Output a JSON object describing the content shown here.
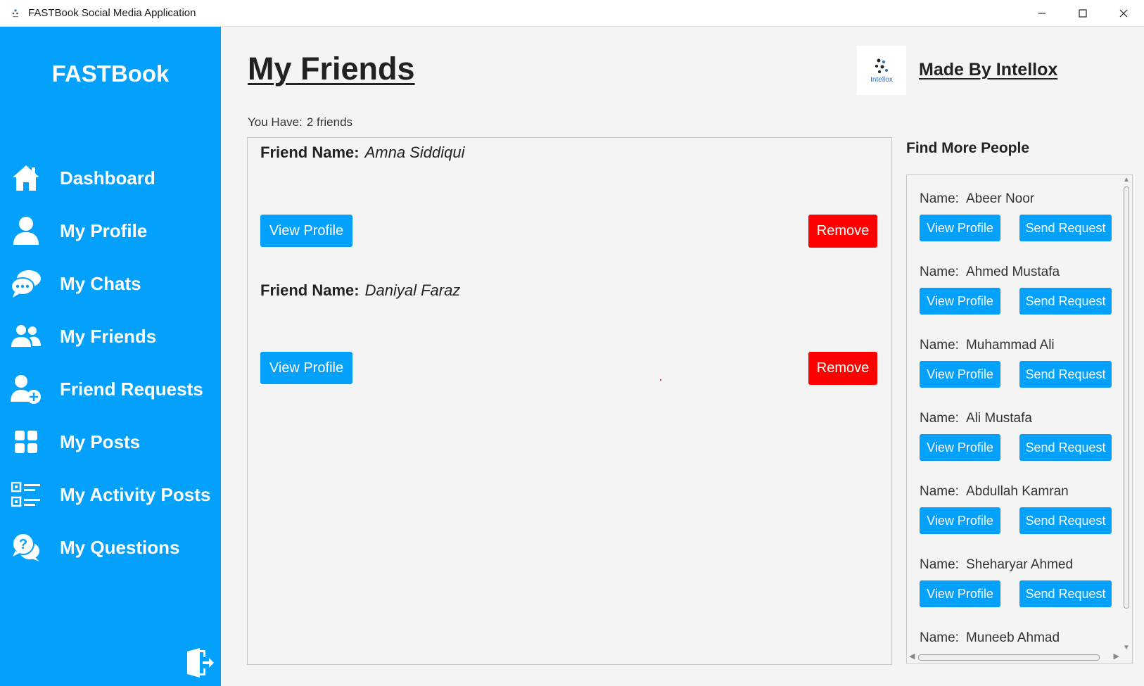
{
  "window": {
    "title": "FASTBook Social Media Application",
    "controls": [
      "minimize",
      "maximize",
      "close"
    ]
  },
  "sidebar": {
    "brand": "FASTBook",
    "items": [
      {
        "label": "Dashboard",
        "icon": "home-icon"
      },
      {
        "label": "My Profile",
        "icon": "user-icon"
      },
      {
        "label": "My Chats",
        "icon": "chat-icon"
      },
      {
        "label": "My Friends",
        "icon": "friends-icon"
      },
      {
        "label": "Friend Requests",
        "icon": "add-user-icon"
      },
      {
        "label": "My Posts",
        "icon": "grid-icon"
      },
      {
        "label": "My Activity Posts",
        "icon": "list-icon"
      },
      {
        "label": "My Questions",
        "icon": "question-chat-icon"
      }
    ],
    "logout_icon": "logout-icon"
  },
  "header": {
    "title": "My Friends",
    "logo_text": "Intellox",
    "made_by": "Made By Intellox"
  },
  "friends": {
    "count_label": "You Have:",
    "count_value": "2 friends",
    "name_label": "Friend Name:",
    "view_label": "View Profile",
    "remove_label": "Remove",
    "list": [
      {
        "name": "Amna Siddiqui"
      },
      {
        "name": "Daniyal Faraz"
      }
    ]
  },
  "find_people": {
    "title": "Find More People",
    "name_label": "Name:",
    "view_label": "View Profile",
    "send_label": "Send Request",
    "list": [
      {
        "name": "Abeer Noor"
      },
      {
        "name": "Ahmed Mustafa"
      },
      {
        "name": "Muhammad Ali"
      },
      {
        "name": "Ali Mustafa"
      },
      {
        "name": "Abdullah Kamran"
      },
      {
        "name": "Sheharyar Ahmed"
      },
      {
        "name": "Muneeb Ahmad"
      }
    ]
  },
  "colors": {
    "accent": "#03a0fc",
    "danger": "#ff0000",
    "background": "#f4f4f4"
  }
}
